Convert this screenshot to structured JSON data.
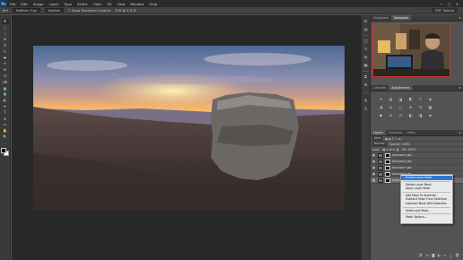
{
  "app": {
    "logo": "Ps",
    "menu": [
      "File",
      "Edit",
      "Image",
      "Layer",
      "Type",
      "Select",
      "Filter",
      "3D",
      "View",
      "Window",
      "Help"
    ],
    "window_controls": [
      "—",
      "□",
      "✕"
    ]
  },
  "options_bar": {
    "size_label": "Feather: 0 px",
    "anti_alias": "Normal",
    "check_label": "Show Transform Controls",
    "workspace": "PDF Tutorial"
  },
  "tools": [
    "move-icon",
    "marquee-icon",
    "lasso-icon",
    "quick-select-icon",
    "crop-icon",
    "eyedropper-icon",
    "healing-icon",
    "brush-icon",
    "stamp-icon",
    "history-brush-icon",
    "eraser-icon",
    "gradient-icon",
    "blur-icon",
    "dodge-icon",
    "pen-icon",
    "type-icon",
    "path-select-icon",
    "shape-icon",
    "hand-icon",
    "zoom-icon",
    "more-icon"
  ],
  "tool_glyphs": [
    "✥",
    "⬚",
    "◌",
    "⊚",
    "⌗",
    "✎",
    "✚",
    "✏",
    "⊕",
    "↺",
    "⌫",
    "▦",
    "💧",
    "◐",
    "✒",
    "T",
    "➤",
    "▭",
    "✋",
    "🔍",
    "…"
  ],
  "strip_icons": [
    "⚙",
    "▤",
    "◫",
    "✎",
    "◍",
    "▣",
    "⧉",
    "⊞",
    "⋯",
    "¶",
    "A"
  ],
  "navigator": {
    "tabs": [
      "Histogram",
      "Navigator"
    ],
    "active": 1
  },
  "adjustments": {
    "tabs": [
      "Libraries",
      "Adjustments"
    ],
    "active": 1,
    "icons": [
      "☀",
      "▥",
      "◪",
      "◩",
      "▽",
      "◈",
      "◑",
      "⚖",
      "▢",
      "⊛",
      "⊟",
      "▩",
      "◆",
      "⊘",
      "⊡",
      "◧",
      "◨",
      "▰"
    ]
  },
  "layers": {
    "tabs": [
      "Layers",
      "Channels",
      "Paths"
    ],
    "active": 0,
    "kind_label": "Kind",
    "blend_mode": "Normal",
    "opacity_label": "Opacity: 100%",
    "lock_label": "Lock:",
    "fill_label": "Fill: 100%",
    "rows": [
      {
        "name": "DSC09875.JPG",
        "selected": false
      },
      {
        "name": "DSC09876.JPG",
        "selected": false
      },
      {
        "name": "DSC09877.JPG",
        "selected": false
      },
      {
        "name": "DSC09878.JPG",
        "selected": false
      },
      {
        "name": "DSC09879.JPG",
        "selected": true
      }
    ],
    "footer_icons": [
      "⛓",
      "fx",
      "◙",
      "◐",
      "▭",
      "▢",
      "🗑"
    ]
  },
  "context_menu": {
    "items": [
      {
        "label": "Enable Layer Mask",
        "highlight": true,
        "sep_after": true
      },
      {
        "label": "Delete Layer Mask",
        "highlight": false,
        "sep_after": false
      },
      {
        "label": "Apply Layer Mask",
        "highlight": false,
        "sep_after": true
      },
      {
        "label": "Add Mask To Selection",
        "highlight": false,
        "sep_after": false
      },
      {
        "label": "Subtract Mask From Selection",
        "highlight": false,
        "sep_after": false
      },
      {
        "label": "Intersect Mask With Selection",
        "highlight": false,
        "sep_after": true
      },
      {
        "label": "Select and Mask...",
        "highlight": false,
        "sep_after": true
      },
      {
        "label": "Mask Options...",
        "highlight": false,
        "sep_after": false
      }
    ]
  },
  "colors": {
    "accent": "#2f77d0",
    "nav_frame": "#cc3333"
  }
}
